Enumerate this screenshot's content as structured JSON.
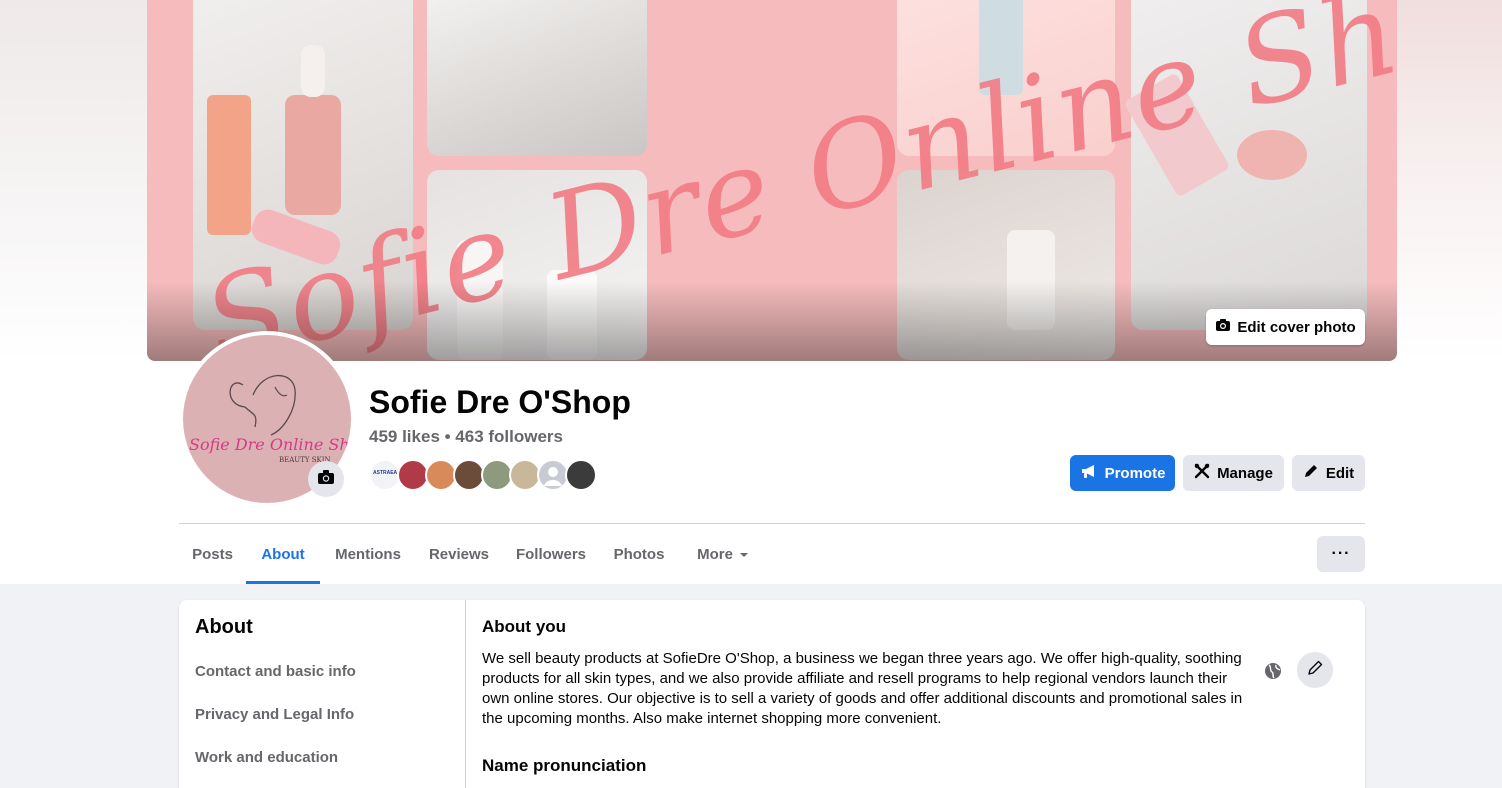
{
  "cover": {
    "script_text": "Sofie Dre Online Shop",
    "edit_label": "Edit cover photo",
    "accent": "#f27b84"
  },
  "profile": {
    "avatar_text": "Sofie Dre Online Shop",
    "avatar_subtext": "BEAUTY SKIN",
    "name": "Sofie Dre O'Shop",
    "stats": "459 likes • 463 followers",
    "follower_faces": [
      {
        "color": "#f2f3f6",
        "label": "ASTRAEA"
      },
      {
        "color": "#b03a48",
        "label": ""
      },
      {
        "color": "#d98a5a",
        "label": ""
      },
      {
        "color": "#6b4b3a",
        "label": ""
      },
      {
        "color": "#8d9a7e",
        "label": ""
      },
      {
        "color": "#c9b79a",
        "label": ""
      },
      {
        "color": "#c8ccd2",
        "label": ""
      },
      {
        "color": "#3b3b3b",
        "label": ""
      }
    ]
  },
  "actions": {
    "promote": "Promote",
    "manage": "Manage",
    "edit": "Edit"
  },
  "tabs": [
    {
      "label": "Posts",
      "active": false
    },
    {
      "label": "About",
      "active": true
    },
    {
      "label": "Mentions",
      "active": false
    },
    {
      "label": "Reviews",
      "active": false
    },
    {
      "label": "Followers",
      "active": false
    },
    {
      "label": "Photos",
      "active": false
    },
    {
      "label": "More",
      "active": false
    }
  ],
  "more_dots": "···",
  "about": {
    "title": "About",
    "links": [
      "Contact and basic info",
      "Privacy and Legal Info",
      "Work and education"
    ],
    "section_title": "About you",
    "description": "We sell beauty products at SofieDre O'Shop, a business we began three years ago. We offer high-quality, soothing products for all skin types, and we also provide affiliate and resell programs to help regional vendors launch their own online stores. Our objective is to sell a variety of goods and offer additional discounts and promotional sales in the upcoming months. Also make internet shopping more convenient.",
    "next_section_title": "Name pronunciation"
  },
  "colors": {
    "primary": "#1b74e4",
    "secondary_bg": "#e4e6eb",
    "muted_text": "#65676b",
    "cover_pink": "#f6bcbd"
  }
}
